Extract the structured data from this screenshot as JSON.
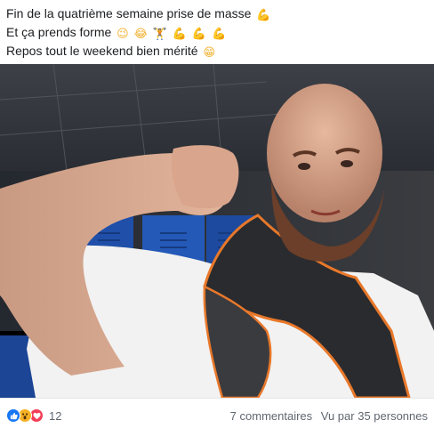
{
  "post": {
    "lines": [
      {
        "text": "Fin de la quatrième semaine prise de masse",
        "emojis": [
          "💪"
        ]
      },
      {
        "text": "Et ça prends forme",
        "emojis": [
          "😉",
          "😂",
          "🏋",
          "💪",
          "💪",
          "💪"
        ]
      },
      {
        "text": "Repos tout le weekend bien mérité",
        "emojis": [
          "😁"
        ]
      }
    ]
  },
  "photo": {
    "subject": "bearded man flexing biceps in locker room",
    "colors": {
      "locker_blue": "#1f4fa8",
      "shirt": "#f2f2f2",
      "towel": "#2a2b2e",
      "towel_trim": "#e8782a",
      "skin": "#d7a48a"
    }
  },
  "footer": {
    "reaction_count": "12",
    "reaction_icons": [
      "like-icon",
      "wow-icon",
      "love-icon"
    ],
    "comments": "7 commentaires",
    "seen_by": "Vu par 35 personnes"
  },
  "colors": {
    "accent_like": "#1877f2",
    "accent_wow": "#f7b125",
    "accent_love": "#f33e58",
    "text_secondary": "#606770"
  }
}
